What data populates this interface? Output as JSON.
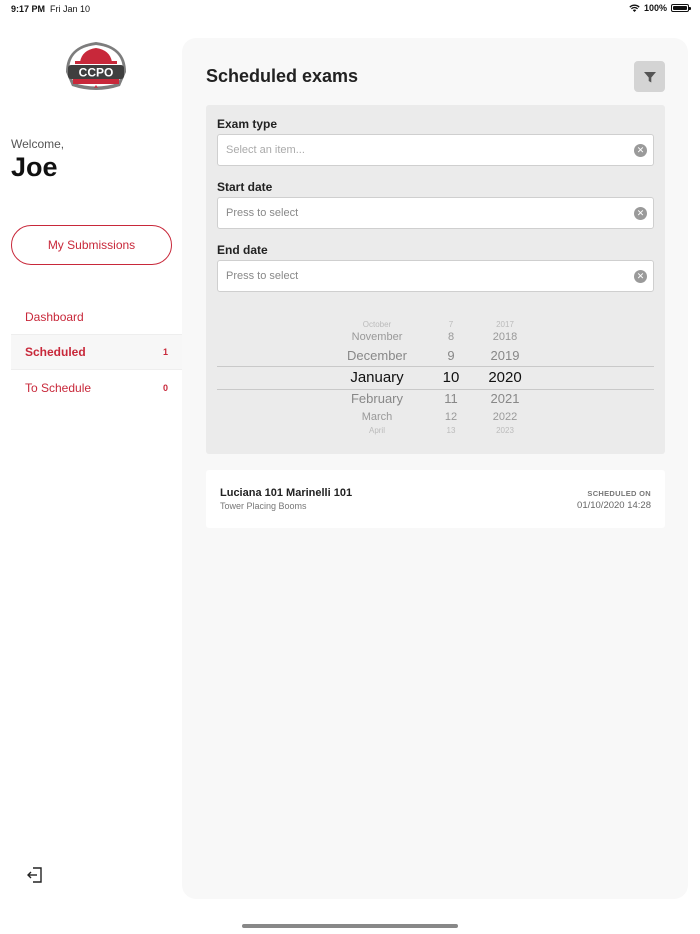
{
  "status_bar": {
    "time": "9:17 PM",
    "date": "Fri Jan 10",
    "battery": "100%"
  },
  "sidebar": {
    "logo_text": "CCPO",
    "welcome": "Welcome,",
    "user_name": "Joe",
    "my_submissions": "My Submissions",
    "nav": [
      {
        "label": "Dashboard",
        "count": ""
      },
      {
        "label": "Scheduled",
        "count": "1"
      },
      {
        "label": "To Schedule",
        "count": "0"
      }
    ],
    "logout_icon": "logout-icon"
  },
  "main": {
    "title": "Scheduled exams",
    "filter_icon": "filter-icon",
    "filters": {
      "exam_type_label": "Exam type",
      "exam_type_placeholder": "Select an item...",
      "start_date_label": "Start date",
      "start_date_value": "Press to select",
      "end_date_label": "End date",
      "end_date_value": "Press to select"
    },
    "picker": {
      "months": [
        "October",
        "November",
        "December",
        "January",
        "February",
        "March",
        "April"
      ],
      "days": [
        "7",
        "8",
        "9",
        "10",
        "11",
        "12",
        "13"
      ],
      "years": [
        "2017",
        "2018",
        "2019",
        "2020",
        "2021",
        "2022",
        "2023"
      ],
      "selected": {
        "month": "January",
        "day": "10",
        "year": "2020"
      }
    },
    "exam": {
      "name": "Luciana 101 Marinelli 101",
      "type": "Tower Placing Booms",
      "scheduled_label": "SCHEDULED ON",
      "scheduled_value": "01/10/2020 14:28"
    }
  }
}
